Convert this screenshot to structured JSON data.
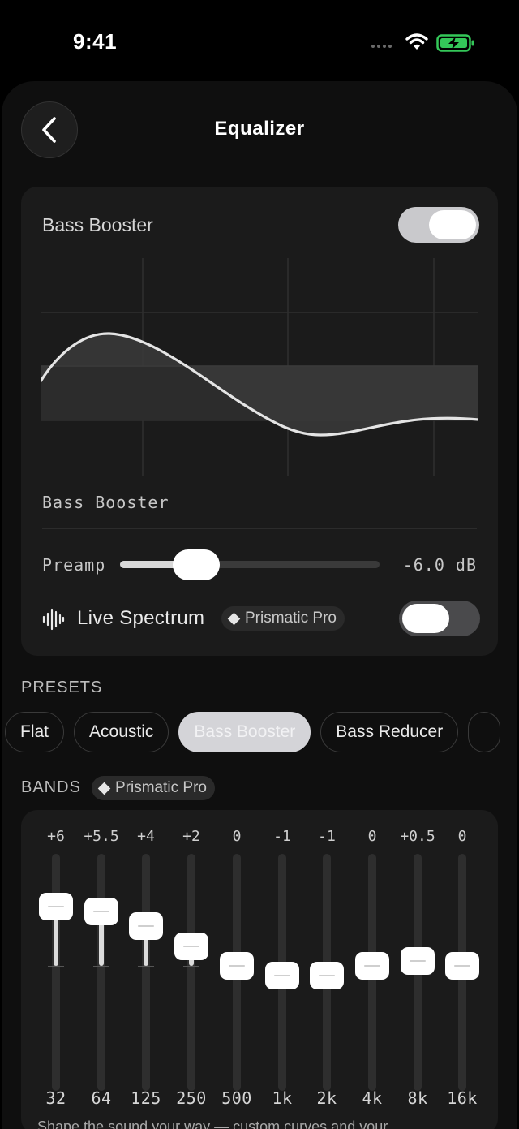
{
  "status": {
    "time": "9:41"
  },
  "header": {
    "title": "Equalizer"
  },
  "eq_card": {
    "title": "Bass Booster",
    "enabled": true,
    "curve_label": "Bass Booster",
    "preamp": {
      "label": "Preamp",
      "value_text": "-6.0 dB",
      "fraction": 0.25
    },
    "live_spectrum": {
      "label": "Live Spectrum",
      "badge": "Prismatic Pro",
      "enabled": false
    }
  },
  "presets": {
    "heading": "PRESETS",
    "items": [
      "Flat",
      "Acoustic",
      "Bass Booster",
      "Bass Reducer"
    ],
    "selected": "Bass Booster"
  },
  "bands": {
    "heading": "BANDS",
    "badge": "Prismatic Pro",
    "items": [
      {
        "freq": "32",
        "gain_text": "+6",
        "gain": 6
      },
      {
        "freq": "64",
        "gain_text": "+5.5",
        "gain": 5.5
      },
      {
        "freq": "125",
        "gain_text": "+4",
        "gain": 4
      },
      {
        "freq": "250",
        "gain_text": "+2",
        "gain": 2
      },
      {
        "freq": "500",
        "gain_text": "0",
        "gain": 0
      },
      {
        "freq": "1k",
        "gain_text": "-1",
        "gain": -1
      },
      {
        "freq": "2k",
        "gain_text": "-1",
        "gain": -1
      },
      {
        "freq": "4k",
        "gain_text": "0",
        "gain": 0
      },
      {
        "freq": "8k",
        "gain_text": "+0.5",
        "gain": 0.5
      },
      {
        "freq": "16k",
        "gain_text": "0",
        "gain": 0
      }
    ]
  },
  "footer": {
    "text": "Shape the sound your way — custom curves and your"
  },
  "colors": {
    "background": "#000000",
    "card": "#1b1b1b",
    "accent": "#ffffff",
    "battery": "#34c759"
  }
}
